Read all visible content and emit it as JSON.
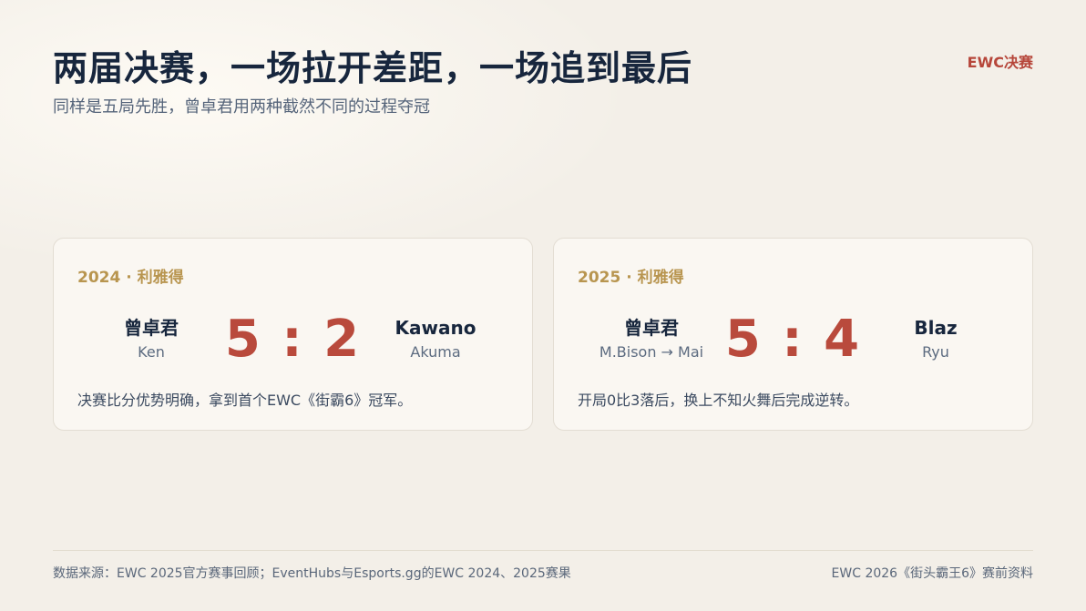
{
  "header": {
    "title": "两届决赛，一场拉开差距，一场追到最后",
    "tag": "EWC决赛",
    "subtitle": "同样是五局先胜，曾卓君用两种截然不同的过程夺冠"
  },
  "cards": [
    {
      "heading": "2024 · 利雅得",
      "left_player": {
        "name": "曾卓君",
        "character": "Ken"
      },
      "score": "5 : 2",
      "right_player": {
        "name": "Kawano",
        "character": "Akuma"
      },
      "note": "决赛比分优势明确，拿到首个EWC《街霸6》冠军。"
    },
    {
      "heading": "2025 · 利雅得",
      "left_player": {
        "name": "曾卓君",
        "character": "M.Bison → Mai"
      },
      "score": "5 : 4",
      "right_player": {
        "name": "Blaz",
        "character": "Ryu"
      },
      "note": "开局0比3落后，换上不知火舞后完成逆转。"
    }
  ],
  "footer": {
    "source": "数据来源：EWC 2025官方赛事回顾；EventHubs与Esports.gg的EWC 2024、2025赛果",
    "right": "EWC 2026《街头霸王6》赛前资料"
  },
  "colors": {
    "background": "#f3efe8",
    "title": "#17263d",
    "accent_red": "#b94a3c",
    "accent_gold": "#b8954f"
  }
}
